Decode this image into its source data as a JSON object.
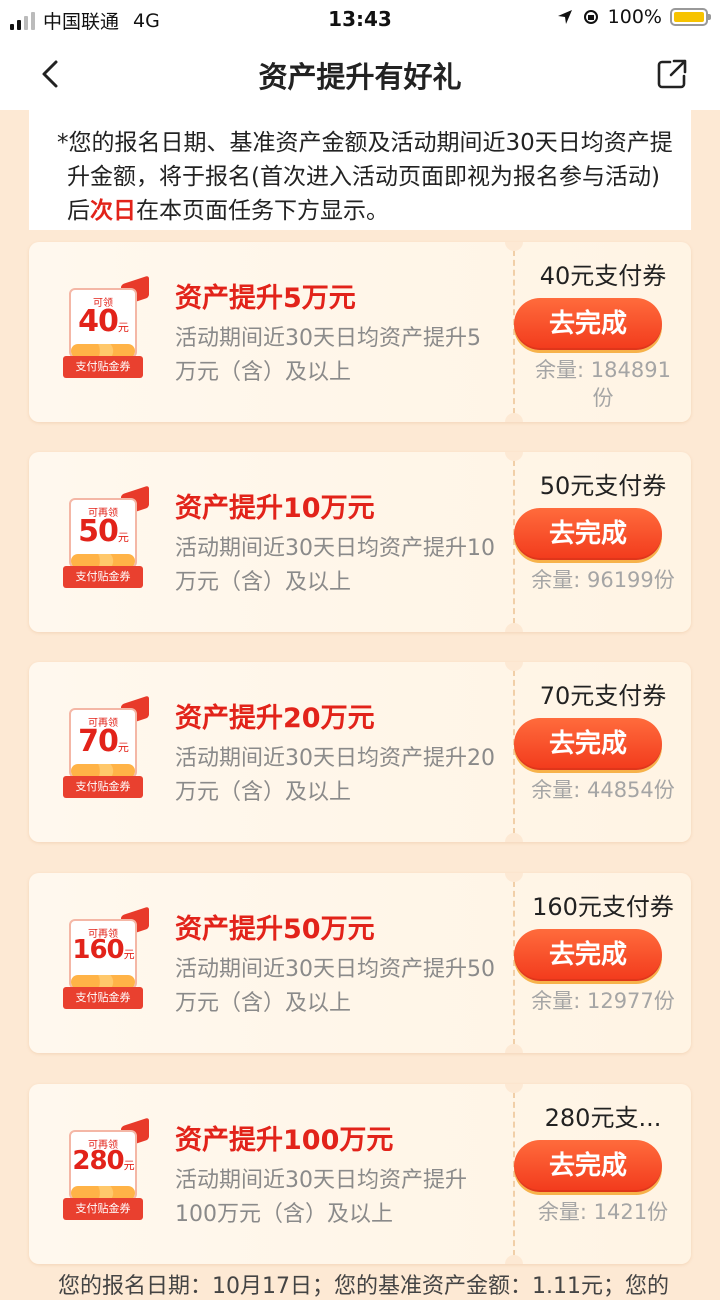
{
  "status_bar": {
    "carrier": "中国联通",
    "network": "4G",
    "time": "13:43",
    "battery": "100%",
    "battery_level": 1.0
  },
  "nav": {
    "title": "资产提升有好礼",
    "back_icon": "chevron-left-icon",
    "share_icon": "share-icon"
  },
  "notice": {
    "text_before": "*您的报名日期、基准资产金额及活动期间近30天日均资产提升金额，将于报名(首次进入活动页面即视为报名参与活动)后",
    "highlight": "次日",
    "text_after": "在本页面任务下方显示。"
  },
  "tasks": [
    {
      "badge_small": "可领",
      "badge_amount": "40",
      "badge_unit": "元",
      "badge_ribbon": "支付贴金券",
      "title": "资产提升5万元",
      "desc": "活动期间近30天日均资产提升5万元（含）及以上",
      "reward": "40元支付券",
      "button": "去完成",
      "stock": "余量: 184891份"
    },
    {
      "badge_small": "可再领",
      "badge_amount": "50",
      "badge_unit": "元",
      "badge_ribbon": "支付贴金券",
      "title": "资产提升10万元",
      "desc": "活动期间近30天日均资产提升10万元（含）及以上",
      "reward": "50元支付券",
      "button": "去完成",
      "stock": "余量: 96199份"
    },
    {
      "badge_small": "可再领",
      "badge_amount": "70",
      "badge_unit": "元",
      "badge_ribbon": "支付贴金券",
      "title": "资产提升20万元",
      "desc": "活动期间近30天日均资产提升20万元（含）及以上",
      "reward": "70元支付券",
      "button": "去完成",
      "stock": "余量: 44854份"
    },
    {
      "badge_small": "可再领",
      "badge_amount": "160",
      "badge_unit": "元",
      "badge_ribbon": "支付贴金券",
      "title": "资产提升50万元",
      "desc": "活动期间近30天日均资产提升50万元（含）及以上",
      "reward": "160元支付券",
      "button": "去完成",
      "stock": "余量: 12977份"
    },
    {
      "badge_small": "可再领",
      "badge_amount": "280",
      "badge_unit": "元",
      "badge_ribbon": "支付贴金券",
      "title": "资产提升100万元",
      "desc": "活动期间近30天日均资产提升100万元（含）及以上",
      "reward": "280元支...",
      "button": "去完成",
      "stock": "余量: 1421份"
    }
  ],
  "footer": {
    "text": "您的报名日期：10月17日；您的基准资产金额：1.11元；您的"
  }
}
